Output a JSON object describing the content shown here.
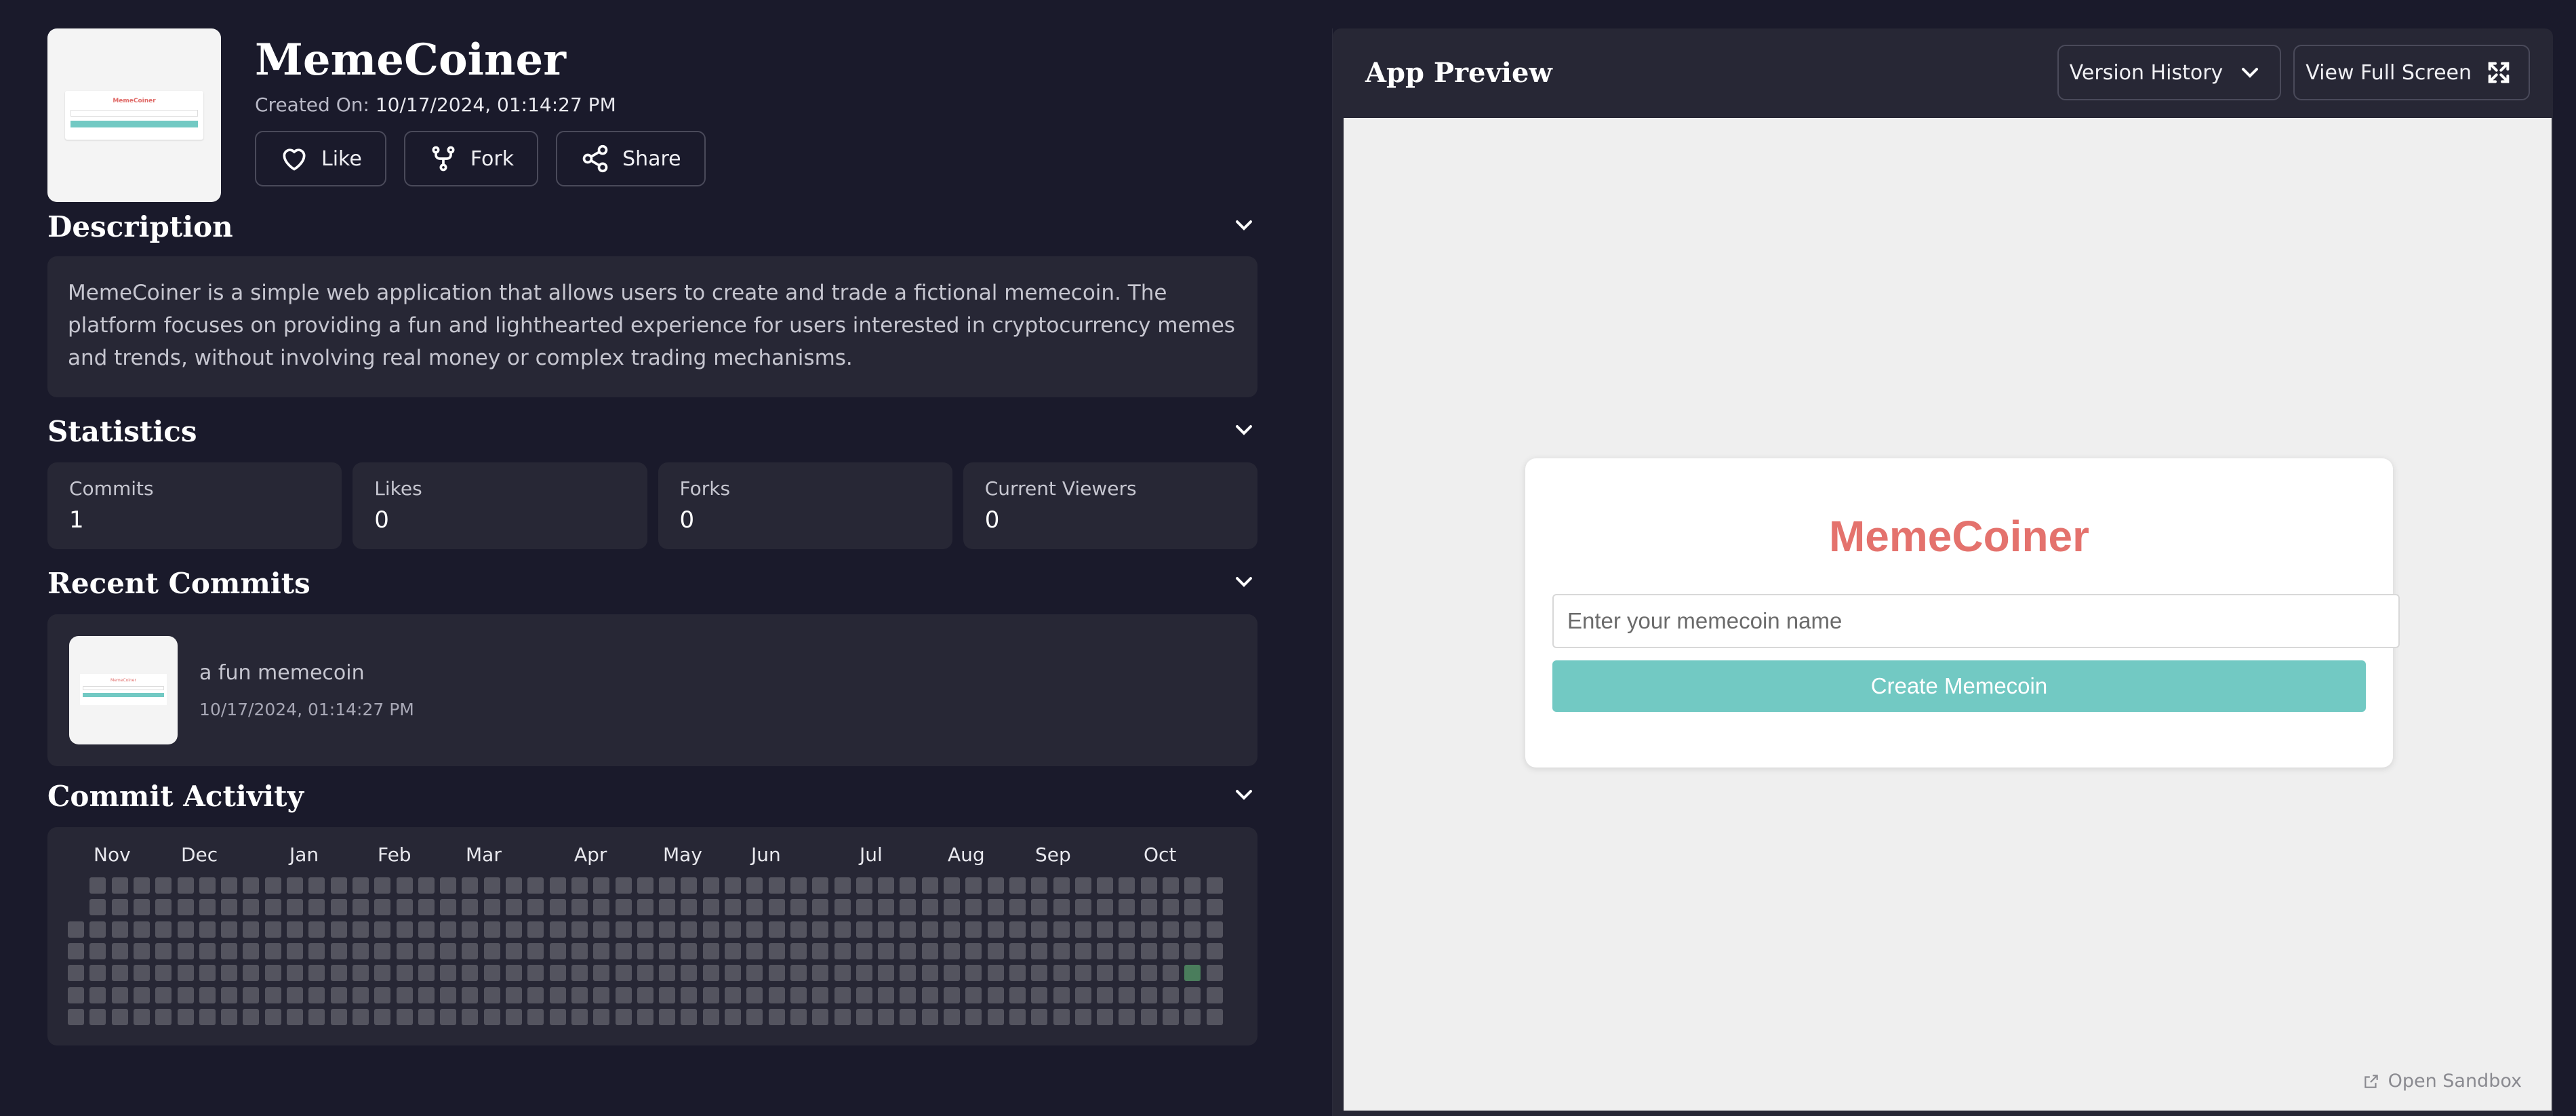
{
  "app": {
    "title": "MemeCoiner",
    "created_label": "Created On: ",
    "created_value": "10/17/2024, 01:14:27 PM",
    "thumb_title": "MemeCoiner"
  },
  "actions": {
    "like": "Like",
    "fork": "Fork",
    "share": "Share"
  },
  "description": {
    "title": "Description",
    "text": "MemeCoiner is a simple web application that allows users to create and trade a fictional memecoin. The platform focuses on providing a fun and lighthearted experience for users interested in cryptocurrency memes and trends, without involving real money or complex trading mechanisms."
  },
  "statistics": {
    "title": "Statistics",
    "items": [
      {
        "label": "Commits",
        "value": "1"
      },
      {
        "label": "Likes",
        "value": "0"
      },
      {
        "label": "Forks",
        "value": "0"
      },
      {
        "label": "Current Viewers",
        "value": "0"
      }
    ]
  },
  "recent_commits": {
    "title": "Recent Commits",
    "items": [
      {
        "message": "a fun memecoin",
        "date": "10/17/2024, 01:14:27 PM"
      }
    ]
  },
  "commit_activity": {
    "title": "Commit Activity",
    "months": [
      "Nov",
      "Dec",
      "Jan",
      "Feb",
      "Mar",
      "Apr",
      "May",
      "Jun",
      "Jul",
      "Aug",
      "Sep",
      "Oct"
    ],
    "weeks": 53,
    "days_per_week": 7,
    "first_week_start_day": 2,
    "last_week_end_day": 6,
    "commits": [
      {
        "week": 51,
        "day": 4,
        "count": 1
      }
    ],
    "colors": {
      "empty": "#54545f",
      "active": "#4a7d5c"
    }
  },
  "preview": {
    "title": "App Preview",
    "version_history": "Version History",
    "full_screen": "View Full Screen",
    "open_sandbox": "Open Sandbox",
    "mini_app": {
      "title": "MemeCoiner",
      "input_placeholder": "Enter your memecoin name",
      "button": "Create Memecoin"
    }
  },
  "colors": {
    "background": "#1a1a2b",
    "card": "#272735",
    "accent_teal": "#72c9c3",
    "accent_red": "#e4726d"
  }
}
